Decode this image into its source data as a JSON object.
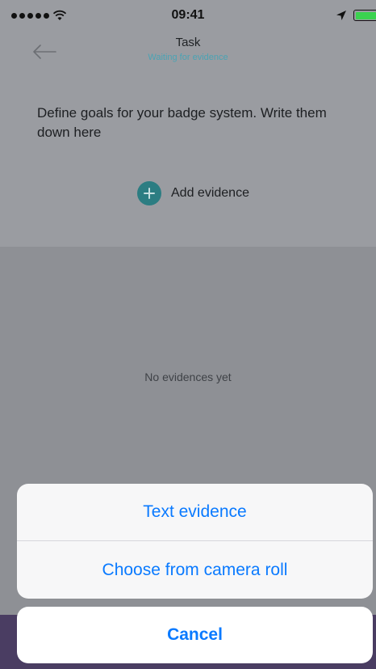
{
  "status_bar": {
    "time": "09:41",
    "icons": [
      "signal-icon",
      "wifi-icon",
      "location-icon",
      "battery-icon"
    ]
  },
  "nav": {
    "back_icon": "arrow-left-icon",
    "title": "Task",
    "subtitle": "Waiting for evidence"
  },
  "task": {
    "description": "Define goals for your badge system. Write them down here"
  },
  "add_evidence": {
    "icon": "plus-circle-icon",
    "label": "Add evidence"
  },
  "evidence_list": {
    "empty_text": "No evidences yet"
  },
  "action_sheet": {
    "items": [
      {
        "label": "Text evidence"
      },
      {
        "label": "Choose from camera roll"
      }
    ],
    "cancel_label": "Cancel"
  },
  "colors": {
    "action_blue": "#0a7aff",
    "subtitle_teal": "#4aa3b4",
    "add_icon_teal": "#2c7d82",
    "bottom_bar_purple": "#4a3d62",
    "battery_green": "#3bd34f"
  }
}
